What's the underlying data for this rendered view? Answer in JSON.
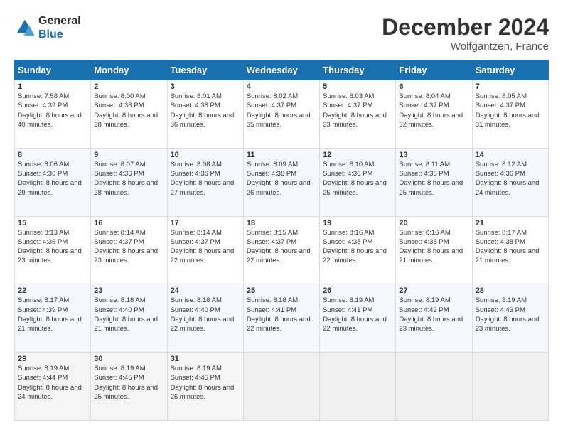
{
  "header": {
    "logo_general": "General",
    "logo_blue": "Blue",
    "month_title": "December 2024",
    "location": "Wolfgantzen, France"
  },
  "days_of_week": [
    "Sunday",
    "Monday",
    "Tuesday",
    "Wednesday",
    "Thursday",
    "Friday",
    "Saturday"
  ],
  "weeks": [
    [
      {
        "day": "1",
        "sunrise": "7:58 AM",
        "sunset": "4:39 PM",
        "daylight": "8 hours and 40 minutes."
      },
      {
        "day": "2",
        "sunrise": "8:00 AM",
        "sunset": "4:38 PM",
        "daylight": "8 hours and 38 minutes."
      },
      {
        "day": "3",
        "sunrise": "8:01 AM",
        "sunset": "4:38 PM",
        "daylight": "8 hours and 36 minutes."
      },
      {
        "day": "4",
        "sunrise": "8:02 AM",
        "sunset": "4:37 PM",
        "daylight": "8 hours and 35 minutes."
      },
      {
        "day": "5",
        "sunrise": "8:03 AM",
        "sunset": "4:37 PM",
        "daylight": "8 hours and 33 minutes."
      },
      {
        "day": "6",
        "sunrise": "8:04 AM",
        "sunset": "4:37 PM",
        "daylight": "8 hours and 32 minutes."
      },
      {
        "day": "7",
        "sunrise": "8:05 AM",
        "sunset": "4:37 PM",
        "daylight": "8 hours and 31 minutes."
      }
    ],
    [
      {
        "day": "8",
        "sunrise": "8:06 AM",
        "sunset": "4:36 PM",
        "daylight": "8 hours and 29 minutes."
      },
      {
        "day": "9",
        "sunrise": "8:07 AM",
        "sunset": "4:36 PM",
        "daylight": "8 hours and 28 minutes."
      },
      {
        "day": "10",
        "sunrise": "8:08 AM",
        "sunset": "4:36 PM",
        "daylight": "8 hours and 27 minutes."
      },
      {
        "day": "11",
        "sunrise": "8:09 AM",
        "sunset": "4:36 PM",
        "daylight": "8 hours and 26 minutes."
      },
      {
        "day": "12",
        "sunrise": "8:10 AM",
        "sunset": "4:36 PM",
        "daylight": "8 hours and 25 minutes."
      },
      {
        "day": "13",
        "sunrise": "8:11 AM",
        "sunset": "4:36 PM",
        "daylight": "8 hours and 25 minutes."
      },
      {
        "day": "14",
        "sunrise": "8:12 AM",
        "sunset": "4:36 PM",
        "daylight": "8 hours and 24 minutes."
      }
    ],
    [
      {
        "day": "15",
        "sunrise": "8:13 AM",
        "sunset": "4:36 PM",
        "daylight": "8 hours and 23 minutes."
      },
      {
        "day": "16",
        "sunrise": "8:14 AM",
        "sunset": "4:37 PM",
        "daylight": "8 hours and 23 minutes."
      },
      {
        "day": "17",
        "sunrise": "8:14 AM",
        "sunset": "4:37 PM",
        "daylight": "8 hours and 22 minutes."
      },
      {
        "day": "18",
        "sunrise": "8:15 AM",
        "sunset": "4:37 PM",
        "daylight": "8 hours and 22 minutes."
      },
      {
        "day": "19",
        "sunrise": "8:16 AM",
        "sunset": "4:38 PM",
        "daylight": "8 hours and 22 minutes."
      },
      {
        "day": "20",
        "sunrise": "8:16 AM",
        "sunset": "4:38 PM",
        "daylight": "8 hours and 21 minutes."
      },
      {
        "day": "21",
        "sunrise": "8:17 AM",
        "sunset": "4:38 PM",
        "daylight": "8 hours and 21 minutes."
      }
    ],
    [
      {
        "day": "22",
        "sunrise": "8:17 AM",
        "sunset": "4:39 PM",
        "daylight": "8 hours and 21 minutes."
      },
      {
        "day": "23",
        "sunrise": "8:18 AM",
        "sunset": "4:40 PM",
        "daylight": "8 hours and 21 minutes."
      },
      {
        "day": "24",
        "sunrise": "8:18 AM",
        "sunset": "4:40 PM",
        "daylight": "8 hours and 22 minutes."
      },
      {
        "day": "25",
        "sunrise": "8:18 AM",
        "sunset": "4:41 PM",
        "daylight": "8 hours and 22 minutes."
      },
      {
        "day": "26",
        "sunrise": "8:19 AM",
        "sunset": "4:41 PM",
        "daylight": "8 hours and 22 minutes."
      },
      {
        "day": "27",
        "sunrise": "8:19 AM",
        "sunset": "4:42 PM",
        "daylight": "8 hours and 23 minutes."
      },
      {
        "day": "28",
        "sunrise": "8:19 AM",
        "sunset": "4:43 PM",
        "daylight": "8 hours and 23 minutes."
      }
    ],
    [
      {
        "day": "29",
        "sunrise": "8:19 AM",
        "sunset": "4:44 PM",
        "daylight": "8 hours and 24 minutes."
      },
      {
        "day": "30",
        "sunrise": "8:19 AM",
        "sunset": "4:45 PM",
        "daylight": "8 hours and 25 minutes."
      },
      {
        "day": "31",
        "sunrise": "8:19 AM",
        "sunset": "4:45 PM",
        "daylight": "8 hours and 26 minutes."
      },
      null,
      null,
      null,
      null
    ]
  ]
}
